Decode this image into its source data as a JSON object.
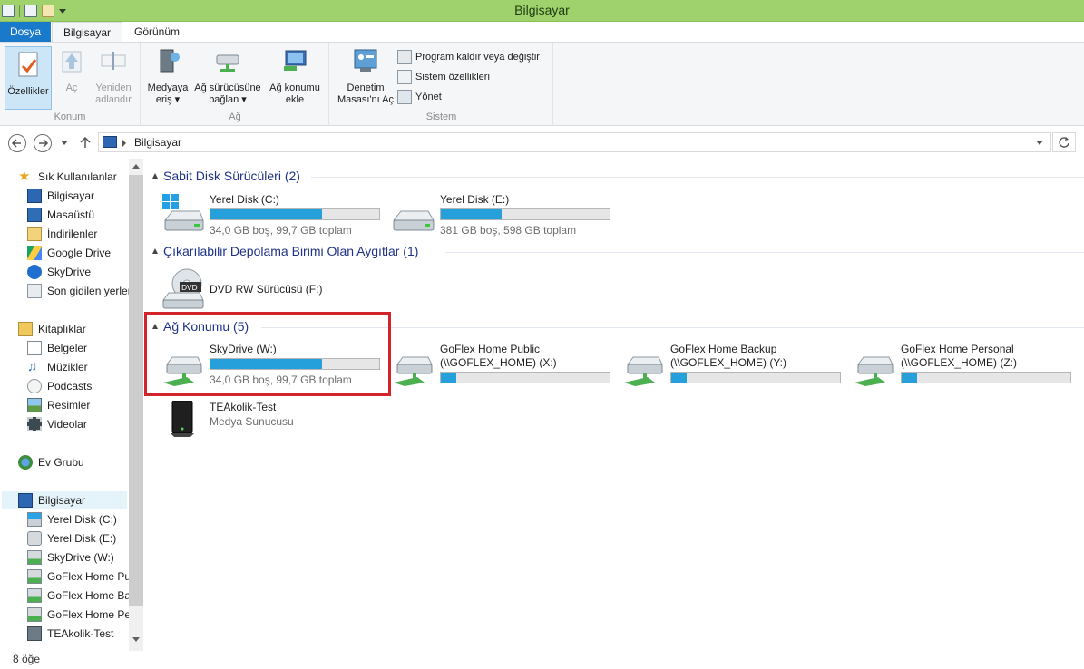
{
  "window": {
    "title": "Bilgisayar"
  },
  "tabs": [
    {
      "label": "Dosya"
    },
    {
      "label": "Bilgisayar"
    },
    {
      "label": "Görünüm"
    }
  ],
  "ribbon": {
    "groups": [
      {
        "label": "Konum",
        "buttons": [
          "Özellikler",
          "Aç",
          "Yeniden adlandır"
        ]
      },
      {
        "label": "Ağ",
        "buttons": [
          "Medyaya eriş",
          "Ağ sürücüsüne bağlan",
          "Ağ konumu ekle"
        ]
      },
      {
        "label": "Sistem",
        "buttons": [
          "Denetim Masası'nı Aç"
        ]
      }
    ],
    "btn_properties": "Özellikler",
    "btn_open": "Aç",
    "btn_rename_1": "Yeniden",
    "btn_rename_2": "adlandır",
    "btn_media_1": "Medyaya",
    "btn_media_2": "eriş",
    "btn_map_1": "Ağ sürücüsüne",
    "btn_map_2": "bağlan",
    "btn_addloc_1": "Ağ konumu",
    "btn_addloc_2": "ekle",
    "btn_cp_1": "Denetim",
    "btn_cp_2": "Masası'nı Aç",
    "small_uninstall": "Program kaldır veya değiştir",
    "small_sysprops": "Sistem özellikleri",
    "small_manage": "Yönet",
    "label_location": "Konum",
    "label_network": "Ağ",
    "label_system": "Sistem"
  },
  "address": {
    "crumb": "Bilgisayar"
  },
  "sidebar": {
    "favorites": "Sık Kullanılanlar",
    "fav_items": [
      "Bilgisayar",
      "Masaüstü",
      "İndirilenler",
      "Google Drive",
      "SkyDrive",
      "Son gidilen yerler"
    ],
    "libraries": "Kitaplıklar",
    "lib_items": [
      "Belgeler",
      "Müzikler",
      "Podcasts",
      "Resimler",
      "Videolar"
    ],
    "homegroup": "Ev Grubu",
    "computer": "Bilgisayar",
    "comp_items": [
      "Yerel Disk (C:)",
      "Yerel Disk (E:)",
      "SkyDrive (W:)",
      "GoFlex Home Public",
      "GoFlex Home Backup",
      "GoFlex Home Personal",
      "TEAkolik-Test"
    ]
  },
  "content": {
    "hdd_group": "Sabit Disk Sürücüleri (2)",
    "removable_group": "Çıkarılabilir Depolama Birimi Olan Aygıtlar (1)",
    "network_group": "Ağ Konumu (5)",
    "drive_c": {
      "name": "Yerel Disk (C:)",
      "info": "34,0 GB boş, 99,7 GB toplam",
      "used": 0.66
    },
    "drive_e": {
      "name": "Yerel Disk (E:)",
      "info": "381 GB boş, 598 GB toplam",
      "used": 0.36
    },
    "drive_f": {
      "name": "DVD RW Sürücüsü (F:)"
    },
    "drive_w": {
      "name": "SkyDrive (W:)",
      "info": "34,0 GB boş, 99,7 GB toplam",
      "used": 0.66
    },
    "drive_x": {
      "name_1": "GoFlex Home Public",
      "name_2": "(\\\\GOFLEX_HOME) (X:)",
      "used": 0.09
    },
    "drive_y": {
      "name_1": "GoFlex Home Backup",
      "name_2": "(\\\\GOFLEX_HOME) (Y:)",
      "used": 0.09
    },
    "drive_z": {
      "name_1": "GoFlex Home Personal",
      "name_2": "(\\\\GOFLEX_HOME) (Z:)",
      "used": 0.09
    },
    "media_server": {
      "name": "TEAkolik-Test",
      "sub": "Medya Sunucusu"
    }
  },
  "status": {
    "count": "8 öğe"
  },
  "colors": {
    "titlebar": "#9fd26c",
    "file_tab": "#1979ca",
    "bar_fill": "#26a0da",
    "highlight": "#d3232b"
  }
}
